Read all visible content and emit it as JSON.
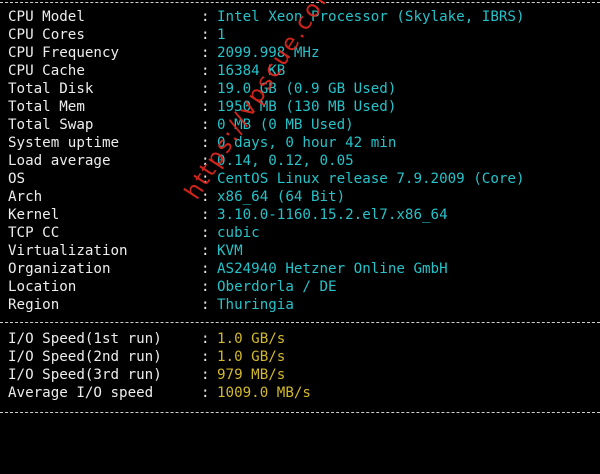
{
  "system": [
    {
      "key": "CPU Model",
      "value": "Intel Xeon Processor (Skylake, IBRS)"
    },
    {
      "key": "CPU Cores",
      "value": "1"
    },
    {
      "key": "CPU Frequency",
      "value": "2099.998 MHz"
    },
    {
      "key": "CPU Cache",
      "value": "16384 KB"
    },
    {
      "key": "Total Disk",
      "value": "19.0 GB (0.9 GB Used)"
    },
    {
      "key": "Total Mem",
      "value": "1950 MB (130 MB Used)"
    },
    {
      "key": "Total Swap",
      "value": "0 MB (0 MB Used)"
    },
    {
      "key": "System uptime",
      "value": "0 days, 0 hour 42 min"
    },
    {
      "key": "Load average",
      "value": "0.14, 0.12, 0.05"
    },
    {
      "key": "OS",
      "value": "CentOS Linux release 7.9.2009 (Core)"
    },
    {
      "key": "Arch",
      "value": "x86_64 (64 Bit)"
    },
    {
      "key": "Kernel",
      "value": "3.10.0-1160.15.2.el7.x86_64"
    },
    {
      "key": "TCP CC",
      "value": "cubic"
    },
    {
      "key": "Virtualization",
      "value": "KVM"
    },
    {
      "key": "Organization",
      "value": "AS24940 Hetzner Online GmbH"
    },
    {
      "key": "Location",
      "value": "Oberdorla / DE"
    },
    {
      "key": "Region",
      "value": "Thuringia"
    }
  ],
  "io": [
    {
      "key": "I/O Speed(1st run)",
      "value": "1.0 GB/s"
    },
    {
      "key": "I/O Speed(2nd run)",
      "value": "1.0 GB/s"
    },
    {
      "key": "I/O Speed(3rd run)",
      "value": "979 MB/s"
    },
    {
      "key": "Average I/O speed",
      "value": "1009.0 MB/s"
    }
  ],
  "separator": ":",
  "watermark": "https://vpscue.com",
  "colors": {
    "background": "#000000",
    "label": "#ededed",
    "value_system": "#25c2c9",
    "value_io": "#d2b82c",
    "watermark": "#e0281e"
  }
}
